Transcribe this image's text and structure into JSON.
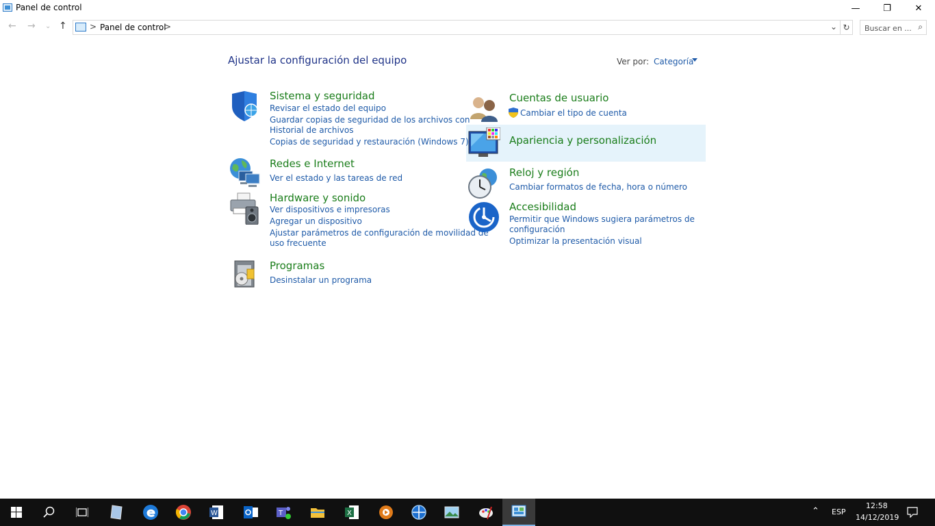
{
  "window": {
    "title": "Panel de control",
    "controls": {
      "minimize": "—",
      "maximize": "❐",
      "close": "✕"
    }
  },
  "address": {
    "crumb": "Panel de control",
    "separator": ">",
    "search_placeholder": "Buscar en ..."
  },
  "main": {
    "heading": "Ajustar la configuración del equipo",
    "view_by_label": "Ver por:",
    "view_by_value": "Categoría"
  },
  "categories": {
    "sistema": {
      "title": "Sistema y seguridad",
      "links": [
        "Revisar el estado del equipo",
        "Guardar copias de seguridad de los archivos con",
        "Historial de archivos",
        "Copias de seguridad y restauración (Windows 7)"
      ]
    },
    "redes": {
      "title": "Redes e Internet",
      "links": [
        "Ver el estado y las tareas de red"
      ]
    },
    "hardware": {
      "title": "Hardware y sonido",
      "links": [
        "Ver dispositivos e impresoras",
        "Agregar un dispositivo",
        "Ajustar parámetros de configuración de movilidad de",
        "uso frecuente"
      ]
    },
    "programas": {
      "title": "Programas",
      "links": [
        "Desinstalar un programa"
      ]
    },
    "cuentas": {
      "title": "Cuentas de usuario",
      "links": [
        "Cambiar el tipo de cuenta"
      ]
    },
    "apariencia": {
      "title": "Apariencia y personalización",
      "links": []
    },
    "reloj": {
      "title": "Reloj y región",
      "links": [
        "Cambiar formatos de fecha, hora o número"
      ]
    },
    "accesibilidad": {
      "title": "Accesibilidad",
      "links": [
        "Permitir que Windows sugiera parámetros de",
        "configuración",
        "Optimizar la presentación visual"
      ]
    }
  },
  "taskbar": {
    "apps": [
      "start",
      "search",
      "task-view",
      "notepad",
      "edge",
      "chrome",
      "word",
      "outlook",
      "teams",
      "file-explorer",
      "excel",
      "vlc",
      "network-app",
      "photos",
      "paint",
      "control-panel"
    ],
    "language": "ESP",
    "time": "12:58",
    "date": "14/12/2019"
  },
  "colors": {
    "link": "#1e5aa8",
    "category_title": "#1a7d1a",
    "heading": "#1e3287",
    "highlight": "#e5f3fb",
    "taskbar": "#101010"
  }
}
